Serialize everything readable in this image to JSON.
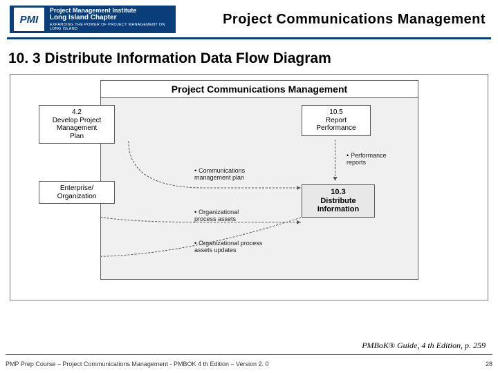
{
  "logo": {
    "badge": "PMI",
    "line1": "Project Management Institute",
    "line2": "Long Island Chapter",
    "tagline": "EXPANDING THE POWER OF PROJECT MANAGEMENT ON LONG ISLAND"
  },
  "header_title": "Project Communications Management",
  "slide_title": "10. 3 Distribute Information Data Flow Diagram",
  "diagram": {
    "group_title": "Project Communications Management",
    "nodes": {
      "develop_plan": "4.2\nDevelop Project\nManagement\nPlan",
      "enterprise_org": "Enterprise/\nOrganization",
      "report_perf": "10.5\nReport\nPerformance",
      "distribute_info": "10.3\nDistribute\nInformation"
    },
    "labels": {
      "comm_mgmt_plan": "Communications\nmanagement plan",
      "perf_reports": "Performance\nreports",
      "org_process_assets": "Organizational\nprocess assets",
      "org_process_assets_updates": "Organizational process\nassets updates"
    }
  },
  "citation": "PMBoK® Guide, 4 th Edition, p. 259",
  "footer_left": "PMP Prep Course – Project Communications Management - PMBOK 4 th Edition – Version 2. 0",
  "footer_page": "28"
}
